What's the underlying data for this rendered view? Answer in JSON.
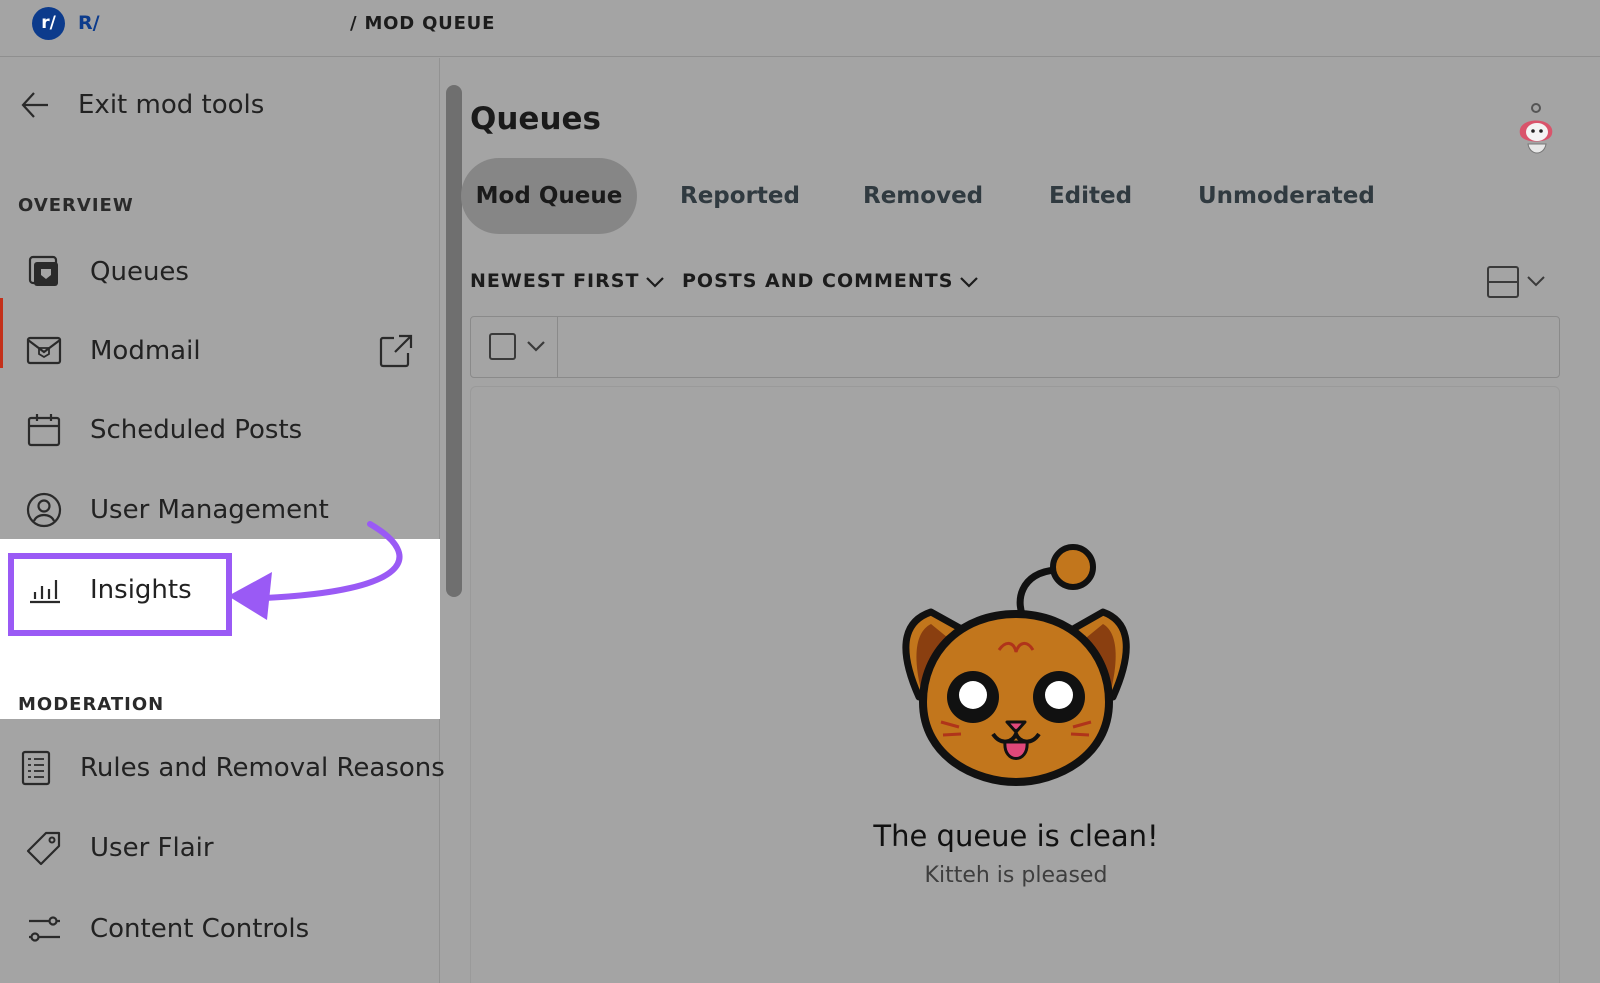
{
  "header": {
    "logo_text": "r/",
    "subreddit_prefix": "R/",
    "breadcrumb": "/ MOD QUEUE"
  },
  "sidebar": {
    "exit_label": "Exit mod tools",
    "overview_title": "OVERVIEW",
    "overview_items": [
      {
        "label": "Queues",
        "icon": "queues-icon"
      },
      {
        "label": "Modmail",
        "icon": "modmail-icon"
      },
      {
        "label": "Scheduled Posts",
        "icon": "calendar-icon"
      },
      {
        "label": "User Management",
        "icon": "user-circle-icon"
      },
      {
        "label": "Insights",
        "icon": "bar-chart-icon"
      }
    ],
    "moderation_title": "MODERATION",
    "moderation_items": [
      {
        "label": "Rules and Removal Reasons",
        "icon": "rules-icon"
      },
      {
        "label": "User Flair",
        "icon": "tag-icon"
      },
      {
        "label": "Content Controls",
        "icon": "sliders-icon"
      }
    ]
  },
  "main": {
    "title": "Queues",
    "tabs": [
      {
        "label": "Mod Queue",
        "active": true
      },
      {
        "label": "Reported",
        "active": false
      },
      {
        "label": "Removed",
        "active": false
      },
      {
        "label": "Edited",
        "active": false
      },
      {
        "label": "Unmoderated",
        "active": false
      }
    ],
    "sort_label": "NEWEST FIRST",
    "type_label": "POSTS AND COMMENTS",
    "empty_title": "The queue is clean!",
    "empty_subtitle": "Kitteh is pleased"
  },
  "colors": {
    "highlight_accent": "#9a5af5",
    "active_marker": "#c4301a",
    "logo": "#0c3b8c",
    "cat_fur": "#c2761c"
  }
}
